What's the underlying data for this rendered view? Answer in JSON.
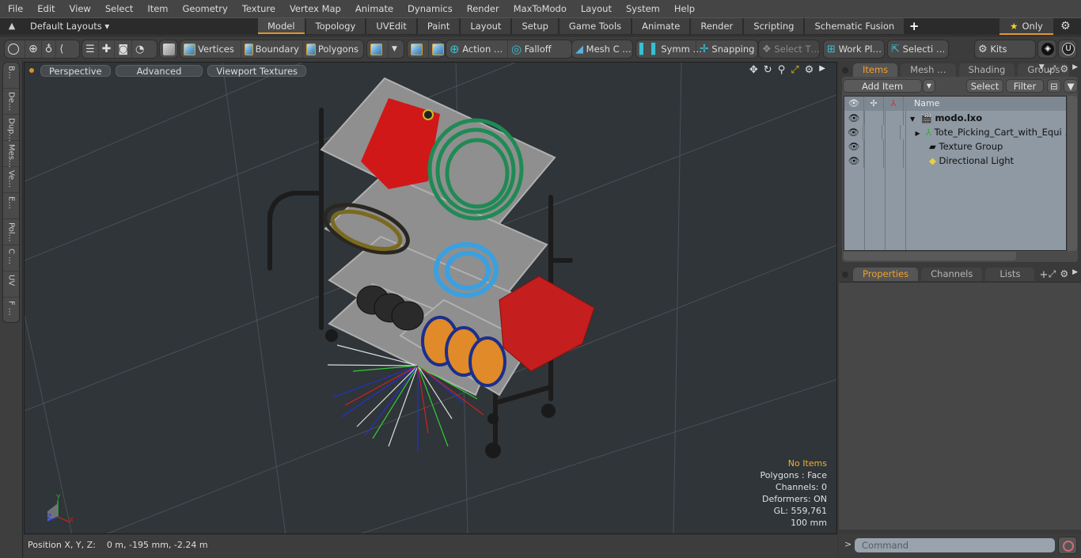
{
  "menubar": {
    "items": [
      "File",
      "Edit",
      "View",
      "Select",
      "Item",
      "Geometry",
      "Texture",
      "Vertex Map",
      "Animate",
      "Dynamics",
      "Render",
      "MaxToModo",
      "Layout",
      "System",
      "Help"
    ]
  },
  "layoutbar": {
    "layout_selector": "Default Layouts ▾",
    "tabs": [
      "Model",
      "Topology",
      "UVEdit",
      "Paint",
      "Layout",
      "Setup",
      "Game Tools",
      "Animate",
      "Render",
      "Scripting",
      "Schematic Fusion"
    ],
    "active_tab": "Model",
    "add_tab": "+",
    "only_label": "Only"
  },
  "toolbar": {
    "selection_modes": [
      "Vertices",
      "Boundary",
      "Polygons"
    ],
    "action_center": "Action …",
    "falloff": "Falloff",
    "mesh_constraint": "Mesh C …",
    "symmetry": "Symm …",
    "snapping": "Snapping",
    "select_through": "Select T…",
    "work_plane": "Work Pl…",
    "selection_sets": "Selecti …",
    "kits": "Kits"
  },
  "left_tabs": [
    "B…",
    "De…",
    "Dup…",
    "Mes…",
    "Ve…",
    "E…",
    "Pol…",
    "C …",
    "UV",
    "F …"
  ],
  "viewport": {
    "view_mode": "Perspective",
    "shading": "Advanced",
    "textures": "Viewport Textures",
    "stats": {
      "selection": "No Items",
      "polygons": "Polygons : Face",
      "channels": "Channels: 0",
      "deformers": "Deformers: ON",
      "gl": "GL: 559,761",
      "scale": "100 mm"
    },
    "axis_labels": {
      "x": "X",
      "y": "Y",
      "z": "Z"
    }
  },
  "statusbar": {
    "position_label": "Position X, Y, Z:",
    "position_value": "0 m, -195 mm, -2.24 m"
  },
  "items_panel": {
    "tabs": [
      "Items",
      "Mesh …",
      "Shading",
      "Groups"
    ],
    "active_tab": "Items",
    "add_item": "Add Item",
    "select": "Select",
    "filter": "Filter",
    "column_name": "Name",
    "rows": [
      {
        "name": "modo.lxo",
        "icon": "scene-icon",
        "bold": true
      },
      {
        "name": "Tote_Picking_Cart_with_Equi …",
        "icon": "mesh-locator-icon"
      },
      {
        "name": "Texture Group",
        "icon": "folder-icon"
      },
      {
        "name": "Directional Light",
        "icon": "light-icon"
      }
    ]
  },
  "properties_panel": {
    "tabs": [
      "Properties",
      "Channels",
      "Lists"
    ],
    "active_tab": "Properties",
    "add_tab": "+"
  },
  "command": {
    "placeholder": "Command",
    "prompt": ">"
  },
  "colors": {
    "accent": "#e0962a",
    "viewport_bg": "#2f3539",
    "tree_bg": "#8f99a3"
  }
}
